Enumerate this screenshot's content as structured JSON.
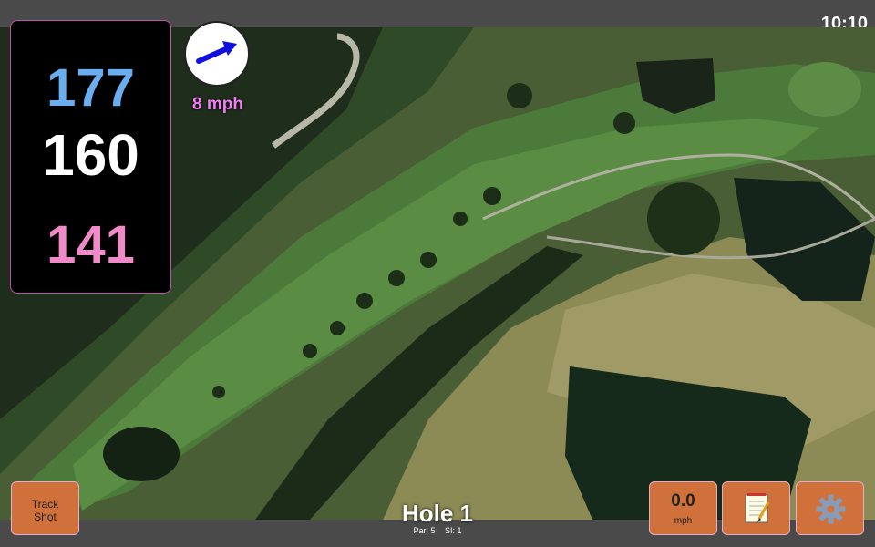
{
  "status_bar": {
    "time": "10:10"
  },
  "distances": {
    "back": "177",
    "middle": "160",
    "front": "141"
  },
  "wind": {
    "speed": "8 mph",
    "arrow_icon": "wind-arrow-icon"
  },
  "hole": {
    "title": "Hole 1",
    "par": "Par: 5",
    "si": "SI: 1"
  },
  "buttons": {
    "track_shot_line1": "Track",
    "track_shot_line2": "Shot",
    "speed_value": "0.0",
    "speed_unit": "mph",
    "notes_icon": "notepad-icon",
    "settings_icon": "gear-icon"
  },
  "colors": {
    "back_distance": "#6aaef0",
    "middle_distance": "#ffffff",
    "front_distance": "#f08ac8",
    "wind_text": "#ee7ff0",
    "button_orange": "#d0703a"
  }
}
